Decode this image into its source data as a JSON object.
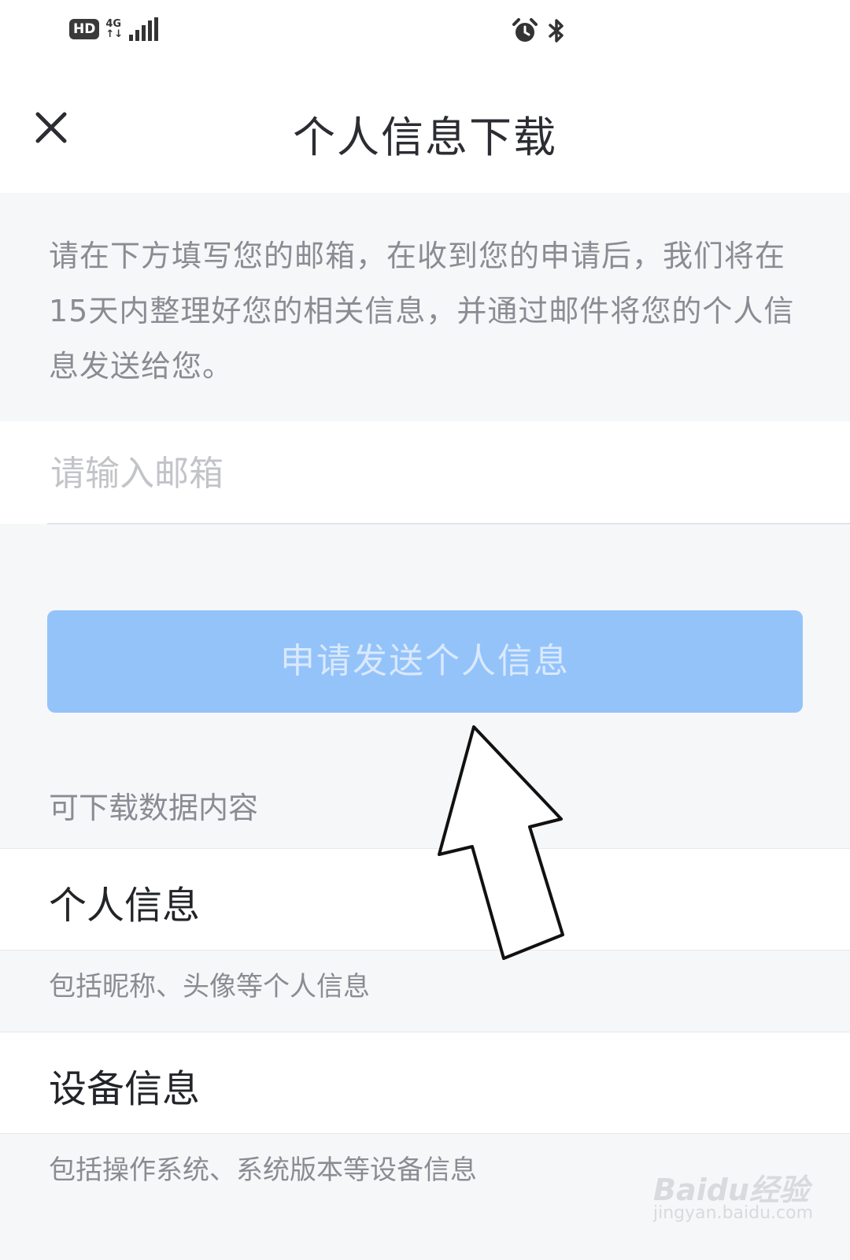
{
  "status_bar": {
    "hd_badge": "HD",
    "network_top": "4G",
    "network_bottom": "↑↓",
    "icons": [
      "hd-icon",
      "signal-icon",
      "alarm-icon",
      "bluetooth-icon"
    ]
  },
  "header": {
    "title": "个人信息下载",
    "close_icon": "close-icon"
  },
  "description": "请在下方填写您的邮箱，在收到您的申请后，我们将在15天内整理好您的相关信息，并通过邮件将您的个人信息发送给您。",
  "email": {
    "placeholder": "请输入邮箱",
    "value": ""
  },
  "submit_button": {
    "label": "申请发送个人信息",
    "enabled": false
  },
  "section": {
    "label": "可下载数据内容"
  },
  "items": [
    {
      "title": "个人信息",
      "description": "包括昵称、头像等个人信息"
    },
    {
      "title": "设备信息",
      "description": "包括操作系统、系统版本等设备信息"
    }
  ],
  "watermark": {
    "logo": "Baidu经验",
    "url": "jingyan.baidu.com"
  },
  "colors": {
    "accent_button": "#94c3fa",
    "page_background": "#f6f7f9",
    "title_text": "#2b2d33",
    "secondary_text": "#8a8c93"
  }
}
